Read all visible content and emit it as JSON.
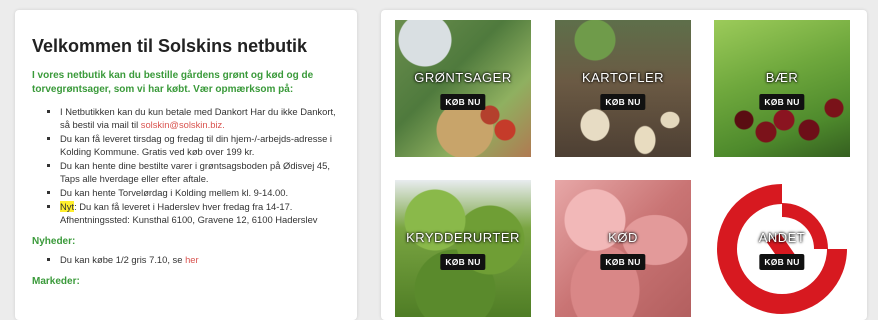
{
  "welcome": {
    "title": "Velkommen til Solskins netbutik",
    "intro": "I vores netbutik kan du bestille gårdens grønt og kød og de torvegrøntsager, som vi har købt. Vær opmærksom på:",
    "bullets": [
      "I Netbutikken kan du kun betale med Dankort Har du ikke Dankort, så bestil via mail til ",
      "Du kan få leveret tirsdag og fredag til din hjem-/-arbejds-adresse i Kolding Kommune. Gratis ved køb over 199 kr.",
      "Du kan hente dine bestilte varer i grøntsagsboden på Ødisvej 45, Taps alle hverdage eller efter aftale.",
      "Du kan hente Torvelørdag i Kolding mellem kl. 9-14.00."
    ],
    "email": "solskin@solskin.biz.",
    "new_label": "Nyt",
    "new_text": ": Du kan få leveret i Haderslev hver fredag fra 14-17. Afhentningssted: Kunsthal 6100, Gravene 12, 6100 Haderslev"
  },
  "news": {
    "heading": "Nyheder:",
    "item_text": "Du kan købe 1/2 gris 7.10, se ",
    "item_link": "her"
  },
  "markets": {
    "heading": "Markeder:"
  },
  "categories": [
    {
      "name": "GRØNTSAGER",
      "button": "KØB NU",
      "image": "vegetables-basket"
    },
    {
      "name": "KARTOFLER",
      "button": "KØB NU",
      "image": "potatoes"
    },
    {
      "name": "BÆR",
      "button": "KØB NU",
      "image": "cherries"
    },
    {
      "name": "KRYDDERURTER",
      "button": "KØB NU",
      "image": "herbs"
    },
    {
      "name": "KØD",
      "button": "KØB NU",
      "image": "meat"
    },
    {
      "name": "ANDET",
      "button": "KØB NU",
      "image": "organic-logo"
    }
  ],
  "colors": {
    "accent_green": "#3a9a3a",
    "link_red": "#d9534f",
    "highlight_yellow": "#ffef2e",
    "logo_red": "#d71920"
  }
}
